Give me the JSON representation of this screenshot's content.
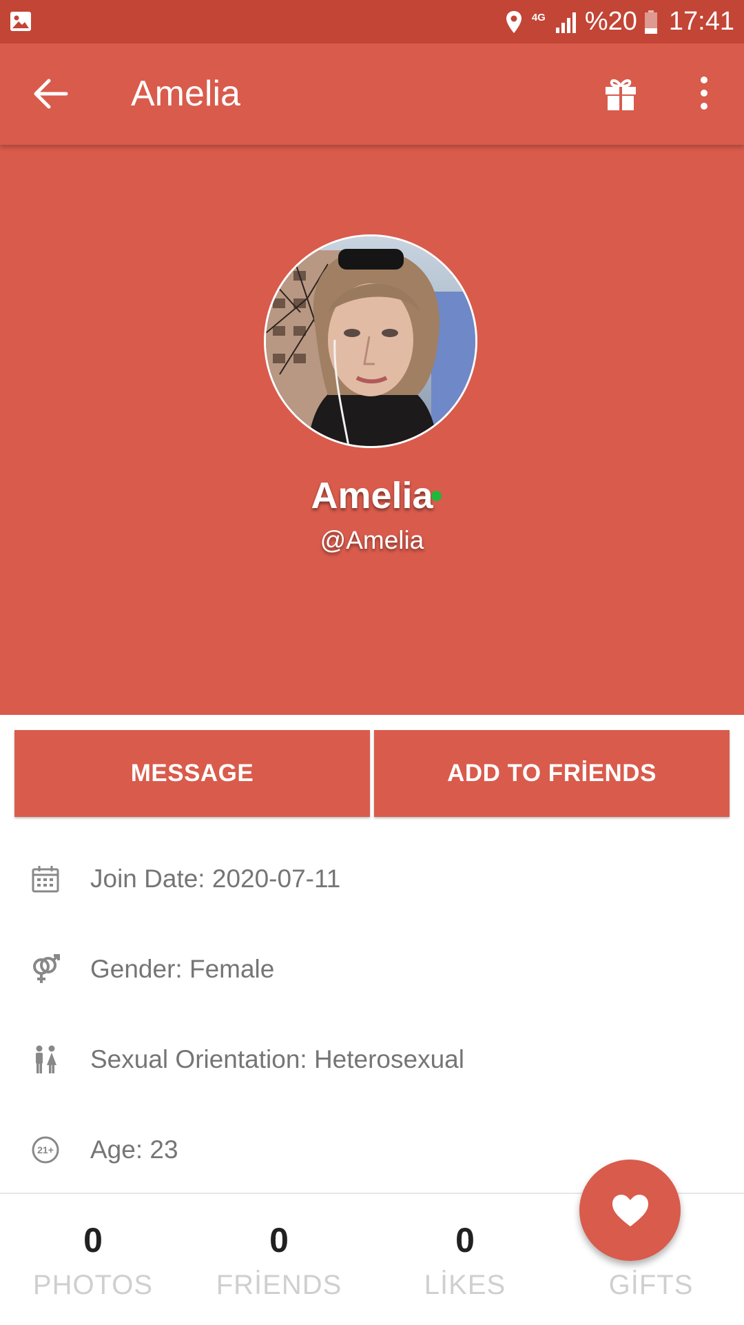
{
  "status_bar": {
    "network": "4G",
    "battery": "%20",
    "time": "17:41"
  },
  "toolbar": {
    "title": "Amelia",
    "icons": [
      "back-arrow-icon",
      "gift-icon",
      "more-vert-icon"
    ]
  },
  "profile": {
    "name": "Amelia",
    "username": "@Amelia",
    "online": true,
    "online_color": "#1fb83a"
  },
  "actions": {
    "message_label": "MESSAGE",
    "add_friend_label": "ADD TO FRİENDS"
  },
  "info": [
    {
      "icon": "calendar-icon",
      "text": "Join Date: 2020-07-11"
    },
    {
      "icon": "gender-icon",
      "text": "Gender: Female"
    },
    {
      "icon": "couple-icon",
      "text": "Sexual Orientation: Heterosexual"
    },
    {
      "icon": "age-21-plus-icon",
      "text": "Age: 23"
    }
  ],
  "stats": [
    {
      "value": "0",
      "label": "PHOTOS"
    },
    {
      "value": "0",
      "label": "FRİENDS"
    },
    {
      "value": "0",
      "label": "LİKES"
    },
    {
      "value": "",
      "label": "GİFTS"
    }
  ],
  "colors": {
    "primary": "#d95b4c",
    "status_bar": "#c34536",
    "accent_text": "#ffffff"
  }
}
